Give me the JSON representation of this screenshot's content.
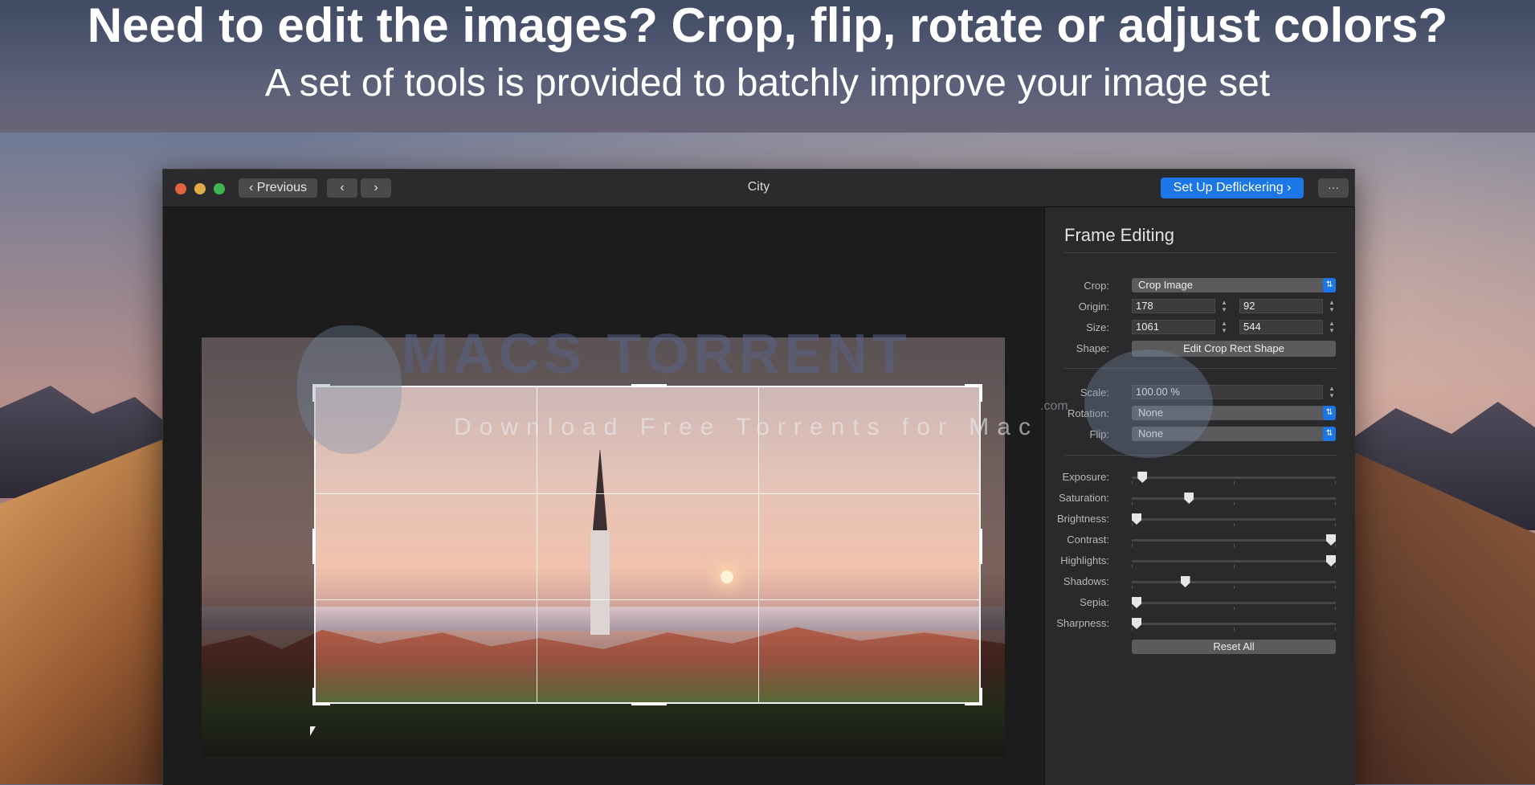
{
  "banner": {
    "headline": "Need to edit the images? Crop, flip, rotate or adjust colors?",
    "subline": "A set of tools is provided to batchly improve your image set"
  },
  "titlebar": {
    "previous_label": "Previous",
    "back_glyph": "‹",
    "forward_glyph": "›",
    "title": "City",
    "primary_label": "Set Up Deflickering ›",
    "more_glyph": "···"
  },
  "watermark": {
    "title": "MACS TORRENT",
    "subtitle": "Download Free Torrents for Mac",
    "com": ".com"
  },
  "panel": {
    "title": "Frame Editing",
    "crop_label": "Crop:",
    "crop_value": "Crop Image",
    "origin_label": "Origin:",
    "origin_x": "178",
    "origin_y": "92",
    "size_label": "Size:",
    "size_w": "1061",
    "size_h": "544",
    "shape_label": "Shape:",
    "shape_button": "Edit Crop Rect Shape",
    "scale_label": "Scale:",
    "scale_value": "100.00 %",
    "rotation_label": "Rotation:",
    "rotation_value": "None",
    "flip_label": "Flip:",
    "flip_value": "None",
    "sliders": [
      {
        "label": "Exposure:",
        "level": 0.03
      },
      {
        "label": "Saturation:",
        "level": 0.27
      },
      {
        "label": "Brightness:",
        "level": 0.0
      },
      {
        "label": "Contrast:",
        "level": 1.0
      },
      {
        "label": "Highlights:",
        "level": 1.0
      },
      {
        "label": "Shadows:",
        "level": 0.25
      },
      {
        "label": "Sepia:",
        "level": 0.0
      },
      {
        "label": "Sharpness:",
        "level": 0.0
      }
    ],
    "reset_label": "Reset All"
  },
  "colors": {
    "accent": "#1b76e8",
    "close": "#e0643f",
    "minimize": "#e3a84a",
    "zoom": "#3fb551"
  }
}
